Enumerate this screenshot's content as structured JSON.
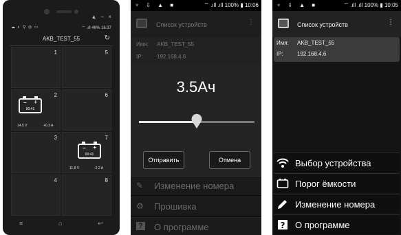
{
  "phone1": {
    "window_controls": "▲ – ×",
    "status_left": "☁ ◐ ⚲ ◎ ▭",
    "status_right": "⌔ .ıll 46% 16:37",
    "app_title": "AKB_TEST_55",
    "refresh_icon": "refresh-icon",
    "cells": [
      {
        "number": "1"
      },
      {
        "number": "5"
      },
      {
        "number": "2",
        "battery_time": "00:41",
        "voltage": "14.5 V",
        "current": "+0.3 A"
      },
      {
        "number": "6"
      },
      {
        "number": "3"
      },
      {
        "number": "7",
        "battery_time": "00:41",
        "voltage": "11.8 V",
        "current": "-2.2 A"
      },
      {
        "number": "4"
      },
      {
        "number": "8"
      }
    ],
    "nav": {
      "menu": "≡",
      "home": "⌂",
      "back": "↩"
    }
  },
  "screen2": {
    "status_left": "♆ ⇩ ▲ ■",
    "status_right": "⌔ .ıll .ıll 100% ▮ 10:06",
    "app_title": "Список устройств",
    "device": {
      "name_label": "Имя:",
      "name": "AKB_TEST_55",
      "ip_label": "IP:",
      "ip": "192.168.4.6"
    },
    "capacity_value": "3.5Ач",
    "slider_fraction": 0.5,
    "send_button": "Отправить",
    "cancel_button": "Отмена",
    "menu": [
      {
        "icon": "pencil-icon",
        "glyph": "✎",
        "label": "Изменение номера"
      },
      {
        "icon": "chip-icon",
        "glyph": "⚙",
        "label": "Прошивка"
      },
      {
        "icon": "help-icon",
        "glyph": "?",
        "label": "О программе"
      }
    ]
  },
  "screen3": {
    "status_left": "♆ ⇩ ▲ ■",
    "status_right": "⌔ .ıll .ıll 100% ▮ 10:05",
    "app_title": "Список устройств",
    "device": {
      "name_label": "Имя:",
      "name": "AKB_TEST_55",
      "ip_label": "IP:",
      "ip": "192.168.4.6"
    },
    "menu": [
      {
        "icon": "wifi-icon",
        "label": "Выбор устройства"
      },
      {
        "icon": "battery-icon",
        "label": "Порог ёмкости"
      },
      {
        "icon": "pencil-icon",
        "label": "Изменение номера"
      },
      {
        "icon": "help-icon",
        "label": "О программе"
      }
    ]
  },
  "colors": {
    "background": "#0d0d0d",
    "app_bar": "#222222",
    "highlight": "#3b3b3b",
    "text": "#ffffff"
  }
}
